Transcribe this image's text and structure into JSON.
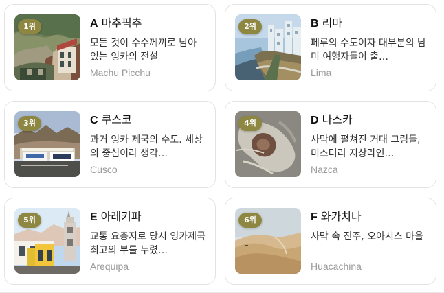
{
  "style": {
    "rank_badge_color": "#8d8742",
    "card_border_color": "#e3e3e3",
    "subtitle_color": "#9a9a9a"
  },
  "cards": [
    {
      "rank": "1위",
      "letter": "A",
      "name": "마추픽추",
      "description": "모든 것이 수수께끼로 남아 있는 잉카의 전설",
      "subtitle": "Machu Picchu"
    },
    {
      "rank": "2위",
      "letter": "B",
      "name": "리마",
      "description": "페루의 수도이자 대부분의 남미 여행자들이 출…",
      "subtitle": "Lima"
    },
    {
      "rank": "3위",
      "letter": "C",
      "name": "쿠스코",
      "description": "과거 잉카 제국의 수도. 세상의 중심이라 생각…",
      "subtitle": "Cusco"
    },
    {
      "rank": "4위",
      "letter": "D",
      "name": "나스카",
      "description": "사막에 펼쳐진 거대 그림들, 미스터리 지상라인…",
      "subtitle": "Nazca"
    },
    {
      "rank": "5위",
      "letter": "E",
      "name": "아레키파",
      "description": "교통 요충지로 당시 잉카제국 최고의 부를 누렸…",
      "subtitle": "Arequipa"
    },
    {
      "rank": "6위",
      "letter": "F",
      "name": "와카치나",
      "description": "사막 속 진주, 오아시스 마을",
      "subtitle": "Huacachina"
    }
  ]
}
